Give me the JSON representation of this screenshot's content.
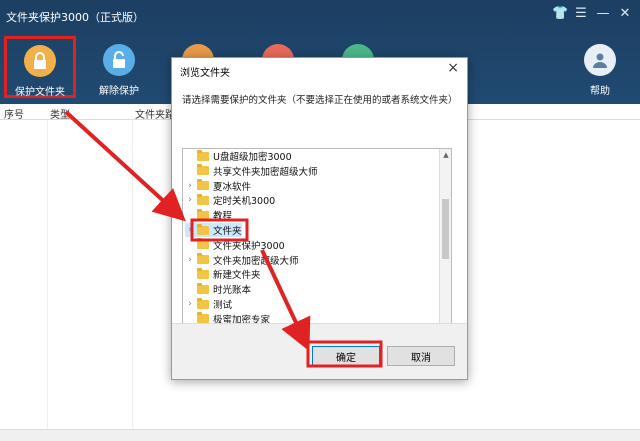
{
  "app": {
    "title": "文件夹保护3000（正式版）",
    "controls": [
      "shirt-icon",
      "menu-icon",
      "minimize-icon",
      "close-icon"
    ]
  },
  "toolbar": {
    "protect_label": "保护文件夹",
    "unprotect_label": "解除保护",
    "help_label": "帮助"
  },
  "table": {
    "columns": [
      "序号",
      "类型",
      "文件夹路"
    ]
  },
  "dialog": {
    "title": "浏览文件夹",
    "instruction": "请选择需要保护的文件夹（不要选择正在使用的或者系统文件夹）",
    "close": "×",
    "tree": [
      {
        "label": "U盘超级加密3000",
        "has_children": false
      },
      {
        "label": "共享文件夹加密超级大师",
        "has_children": false
      },
      {
        "label": "夏冰软件",
        "has_children": true
      },
      {
        "label": "定时关机3000",
        "has_children": true
      },
      {
        "label": "教程",
        "has_children": false
      },
      {
        "label": "文件夹",
        "has_children": true,
        "selected": true
      },
      {
        "label": "文件夹保护3000",
        "has_children": false
      },
      {
        "label": "文件夹加密超级大师",
        "has_children": true
      },
      {
        "label": "新建文件夹",
        "has_children": false
      },
      {
        "label": "时光账本",
        "has_children": false
      },
      {
        "label": "测试",
        "has_children": true
      },
      {
        "label": "极蜜加密专家",
        "has_children": false
      }
    ],
    "ok_label": "确定",
    "cancel_label": "取消"
  },
  "colors": {
    "titlebar": "#1c3f62",
    "highlight": "#e02222",
    "folder": "#f1c445"
  }
}
